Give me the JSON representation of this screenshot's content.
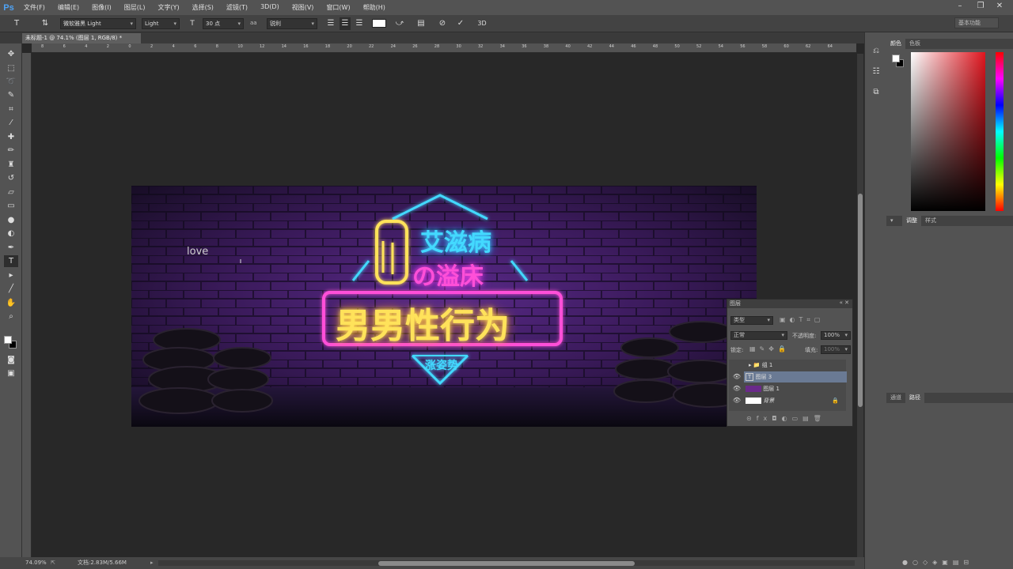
{
  "app": {
    "logo": "Ps"
  },
  "menu": [
    "文件(F)",
    "编辑(E)",
    "图像(I)",
    "图层(L)",
    "文字(Y)",
    "选择(S)",
    "滤镜(T)",
    "3D(D)",
    "视图(V)",
    "窗口(W)",
    "帮助(H)"
  ],
  "options": {
    "font_family": "微软雅黑 Light",
    "font_style": "Light",
    "font_size": "30 点",
    "aa_label": "aa",
    "antialias": "锐利",
    "workspace": "基本功能"
  },
  "document": {
    "tab_title": "未标题-1 @ 74.1% (图层 1, RGB/8) *",
    "zoom": "74.09%",
    "doc_info": "文档:2.83M/5.66M",
    "ruler_marks": [
      "8",
      "6",
      "4",
      "2",
      "0",
      "2",
      "4",
      "6",
      "8",
      "10",
      "12",
      "14",
      "16",
      "18",
      "20",
      "22",
      "24",
      "26",
      "28",
      "30",
      "32",
      "34",
      "36",
      "38",
      "40",
      "42",
      "44",
      "46",
      "48",
      "50",
      "52",
      "54",
      "56",
      "58",
      "60",
      "62",
      "64"
    ]
  },
  "canvas": {
    "typed_text": "love",
    "neon_title_1": "艾滋病",
    "neon_title_2": "の溢床",
    "neon_main": "男男性行为",
    "neon_tag": "涨姿势"
  },
  "panels": {
    "color_tabs": [
      "颜色",
      "色板"
    ],
    "adjust_tabs": [
      "调整",
      "样式"
    ],
    "paths_tabs": [
      "通道",
      "路径"
    ],
    "layers": {
      "title": "图层",
      "filter_kind": "类型",
      "blend_mode": "正常",
      "opacity_label": "不透明度:",
      "opacity_value": "100%",
      "lock_label": "锁定:",
      "fill_label": "填充:",
      "fill_value": "100%",
      "rows": [
        {
          "name": "组 1",
          "type": "group"
        },
        {
          "name": "图层 3",
          "type": "text",
          "selected": true
        },
        {
          "name": "图层 1",
          "type": "image"
        },
        {
          "name": "背景",
          "type": "background"
        }
      ]
    }
  },
  "colors": {
    "accent": "#4fa3f5",
    "foreground": "#ffffff",
    "background_swatch": "#000000",
    "neon_yellow": "#ffe25a",
    "neon_pink": "#ff4fd8",
    "neon_cyan": "#43d9ff"
  }
}
